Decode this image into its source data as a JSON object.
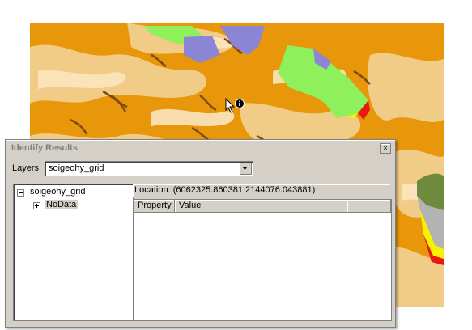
{
  "map": {
    "colors": {
      "base": "#e8960a",
      "light": "#f2cf8e",
      "pale": "#fbe6bf",
      "dark": "#7a4a10",
      "green": "#8ef05a",
      "purple": "#8b85d6",
      "red": "#e81a10",
      "yellow": "#f7f200",
      "gray": "#b3b3b3",
      "olive": "#6e8b3d"
    }
  },
  "cursor": {
    "icon": "identify-cursor-icon"
  },
  "window": {
    "title": "Identify Results",
    "close_glyph": "×",
    "layers_label": "Layers:",
    "layers_value": "soigeohy_grid",
    "tree": {
      "root": {
        "label": "soigeohy_grid",
        "toggle": "minus"
      },
      "child": {
        "label": "NoData",
        "toggle": "plus"
      }
    },
    "location": "Location: (6062325.860381 2144076.043881)",
    "columns": [
      "Property",
      "Value"
    ]
  }
}
